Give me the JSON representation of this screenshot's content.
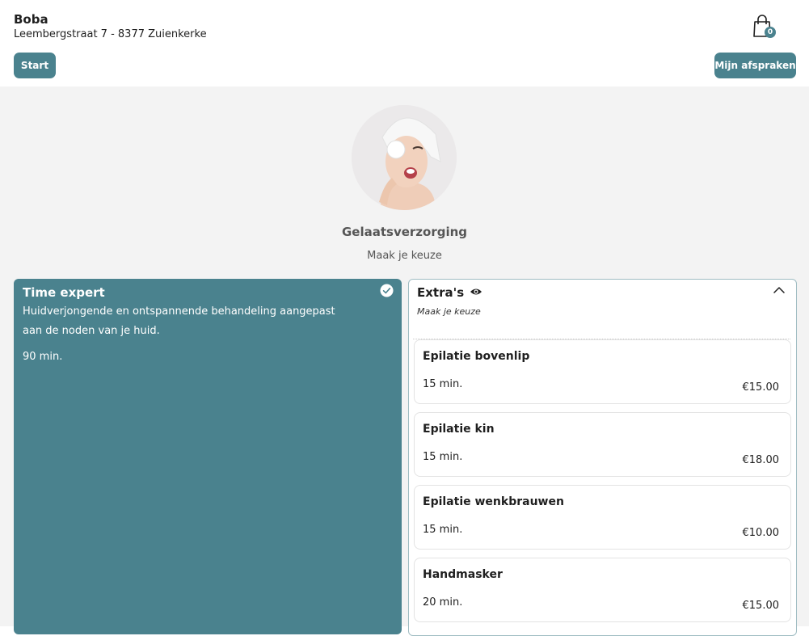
{
  "header": {
    "shop_name": "Boba",
    "address": "Leembergstraat 7 - 8377 Zuienkerke",
    "start_label": "Start",
    "appointments_label": "Mijn afspraken",
    "cart_count": "0"
  },
  "category": {
    "title": "Gelaatsverzorging",
    "subtitle": "Maak je keuze"
  },
  "selected": {
    "title": "Time expert",
    "description": "Huidverjongende en ontspannende behandeling aangepast aan de noden van je huid.",
    "duration": "90 min."
  },
  "extras": {
    "title": "Extra's",
    "subtitle": "Maak je keuze",
    "items": [
      {
        "name": "Epilatie bovenlip",
        "duration": "15 min.",
        "price": "€15.00"
      },
      {
        "name": "Epilatie kin",
        "duration": "15 min.",
        "price": "€18.00"
      },
      {
        "name": "Epilatie wenkbrauwen",
        "duration": "15 min.",
        "price": "€10.00"
      },
      {
        "name": "Handmasker",
        "duration": "20 min.",
        "price": "€15.00"
      }
    ]
  },
  "colors": {
    "accent": "#4a828e",
    "background": "#f3f3f3"
  },
  "icons": {
    "cart": "shopping-bag-icon",
    "check": "check-circle-icon",
    "eye": "eye-icon",
    "chevron": "chevron-up-icon"
  }
}
